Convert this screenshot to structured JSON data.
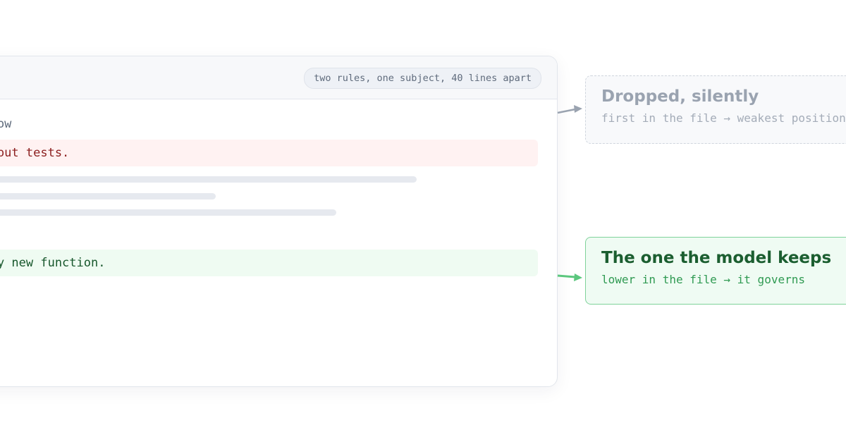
{
  "card": {
    "header_pill": "two rules, one subject, 40 lines apart",
    "heading": "rkflow",
    "rule_dropped": " without tests.",
    "rule_kept": "every new function."
  },
  "callouts": {
    "dropped": {
      "title": "Dropped, silently",
      "subtitle": "first in the file → weakest position"
    },
    "kept": {
      "title": "The one the model keeps",
      "subtitle": "lower in the file → it governs"
    }
  },
  "colors": {
    "drop_arrow": "#9aa3b0",
    "keep_arrow": "#5cc77e",
    "rule_bad_bg": "#fff2f2",
    "rule_good_bg": "#effbf2"
  }
}
